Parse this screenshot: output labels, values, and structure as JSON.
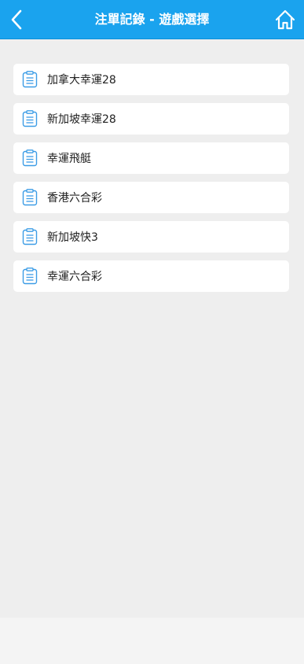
{
  "header": {
    "title": "注單記錄 - 遊戲選擇",
    "back_icon": "chevron-left-icon",
    "home_icon": "home-icon",
    "bg_color": "#1aa3ee"
  },
  "games": [
    {
      "label": "加拿大幸運28",
      "icon": "clipboard-list-icon"
    },
    {
      "label": "新加坡幸運28",
      "icon": "clipboard-list-icon"
    },
    {
      "label": "幸運飛艇",
      "icon": "clipboard-list-icon"
    },
    {
      "label": "香港六合彩",
      "icon": "clipboard-list-icon"
    },
    {
      "label": "新加坡快3",
      "icon": "clipboard-list-icon"
    },
    {
      "label": "幸運六合彩",
      "icon": "clipboard-list-icon"
    }
  ],
  "colors": {
    "accent": "#1aa3ee",
    "icon": "#3b9ce6",
    "page_bg": "#eeeeee",
    "card_bg": "#ffffff"
  }
}
